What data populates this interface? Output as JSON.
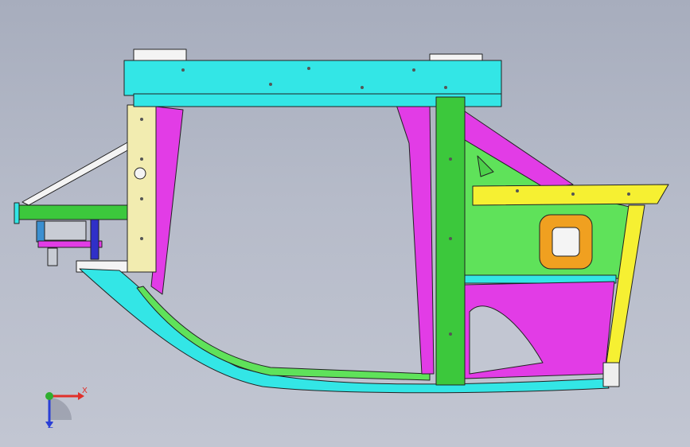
{
  "viewport": {
    "background_top": "#a7adbd",
    "background_bottom": "#c2c6d2"
  },
  "model": {
    "part_colors": {
      "frame_cyan": "#33e6e6",
      "beam_yellow": "#f6f032",
      "pillar_cream": "#f2ecb0",
      "panel_magenta": "#e23ce6",
      "post_green": "#3cc83c",
      "panel_green": "#5fe25a",
      "bracket_blue": "#3030c8",
      "boss_orange": "#f0a020",
      "edge_dark": "#222222"
    },
    "icons": [
      "fixture-frame",
      "door-assembly"
    ]
  },
  "triad": {
    "x_label": "X",
    "z_label": "Z",
    "x_color": "#e0302a",
    "y_color": "#2fae2f",
    "z_color": "#2a3fd6"
  }
}
